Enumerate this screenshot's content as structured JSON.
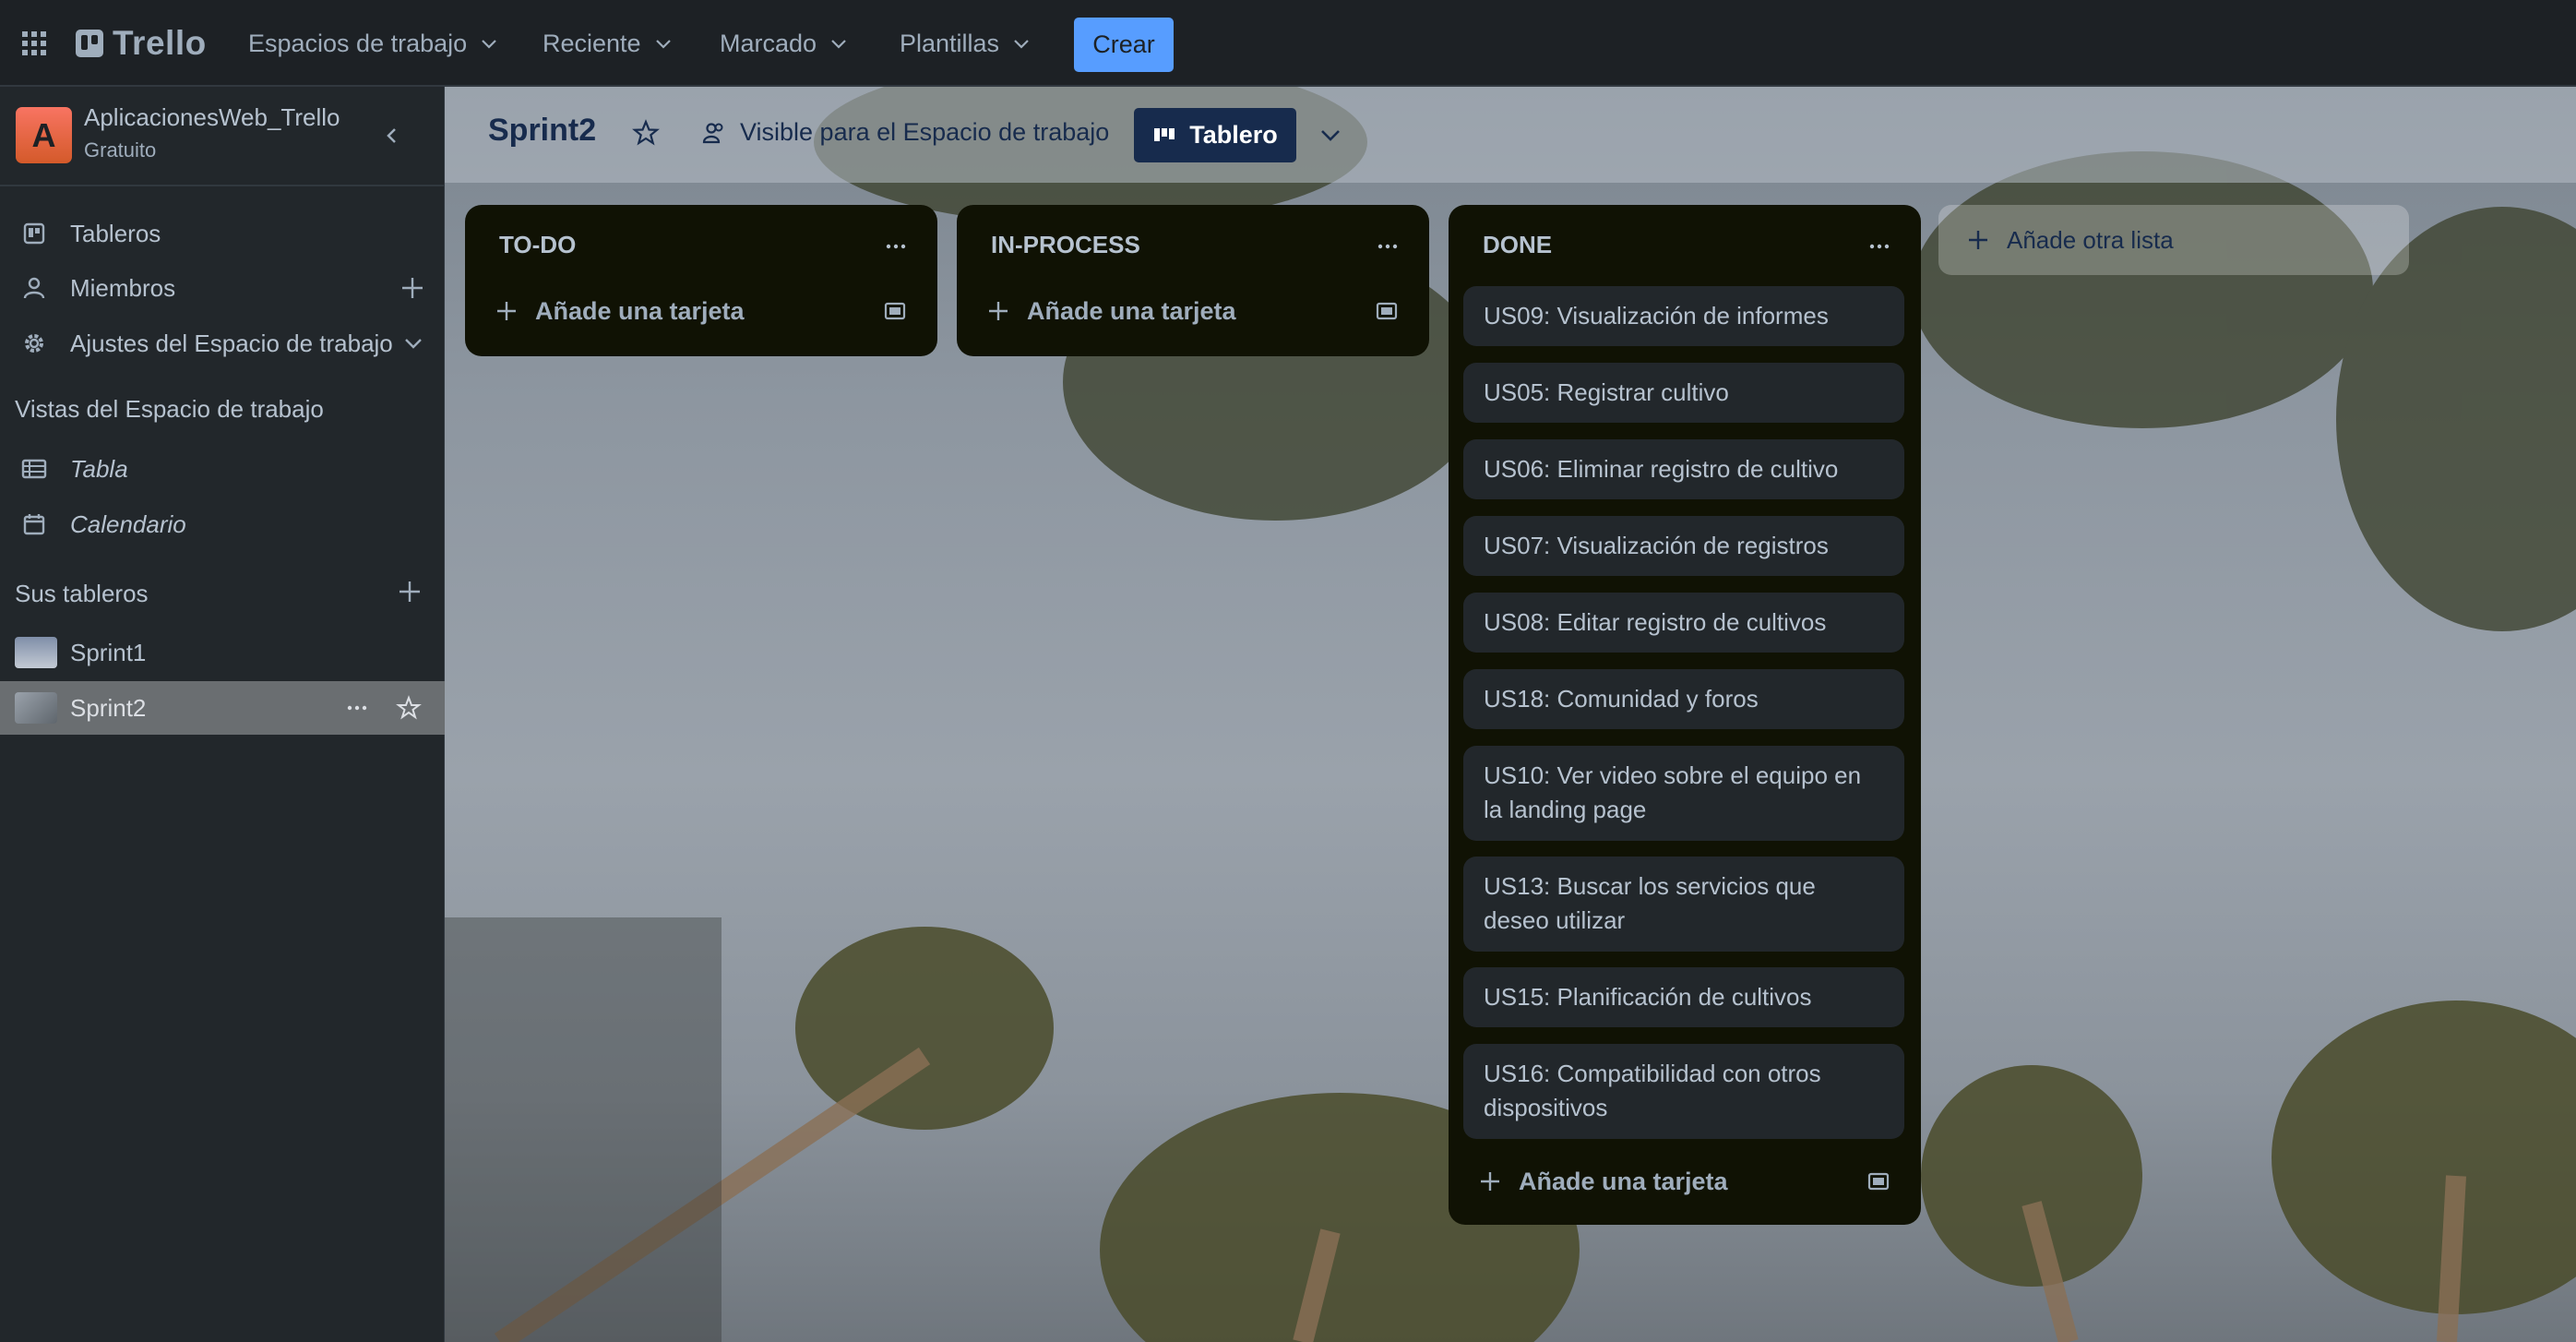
{
  "topbar": {
    "logo": "Trello",
    "menus": [
      "Espacios de trabajo",
      "Reciente",
      "Marcado",
      "Plantillas"
    ],
    "create_label": "Crear"
  },
  "sidebar": {
    "workspace_initial": "A",
    "workspace_name": "AplicacionesWeb_Trello",
    "workspace_plan": "Gratuito",
    "nav": {
      "boards": "Tableros",
      "members": "Miembros",
      "settings": "Ajustes del Espacio de trabajo"
    },
    "views_heading": "Vistas del Espacio de trabajo",
    "views": [
      "Tabla",
      "Calendario"
    ],
    "boards_heading": "Sus tableros",
    "boards": [
      "Sprint1",
      "Sprint2"
    ]
  },
  "board": {
    "title": "Sprint2",
    "visibility": "Visible para el Espacio de trabajo",
    "view_label": "Tablero",
    "lists": [
      {
        "title": "TO-DO",
        "add_card": "Añade una tarjeta",
        "cards": []
      },
      {
        "title": "IN-PROCESS",
        "add_card": "Añade una tarjeta",
        "cards": []
      },
      {
        "title": "DONE",
        "add_card": "Añade una tarjeta",
        "cards": [
          "US09: Visualización de informes",
          "US05: Registrar cultivo",
          "US06: Eliminar registro de cultivo",
          "US07: Visualización de registros",
          "US08: Editar registro de cultivos",
          "US18: Comunidad y foros",
          "US10: Ver video sobre el equipo en la landing page",
          "US13: Buscar los servicios que deseo utilizar",
          "US15: Planificación de cultivos",
          "US16: Compatibilidad con otros dispositivos"
        ]
      }
    ],
    "add_list": "Añade otra lista"
  },
  "colors": {
    "accent": "#579dff",
    "list_bg": "#101204",
    "card_bg": "#22272b",
    "sidebar_bg": "#22272b"
  }
}
